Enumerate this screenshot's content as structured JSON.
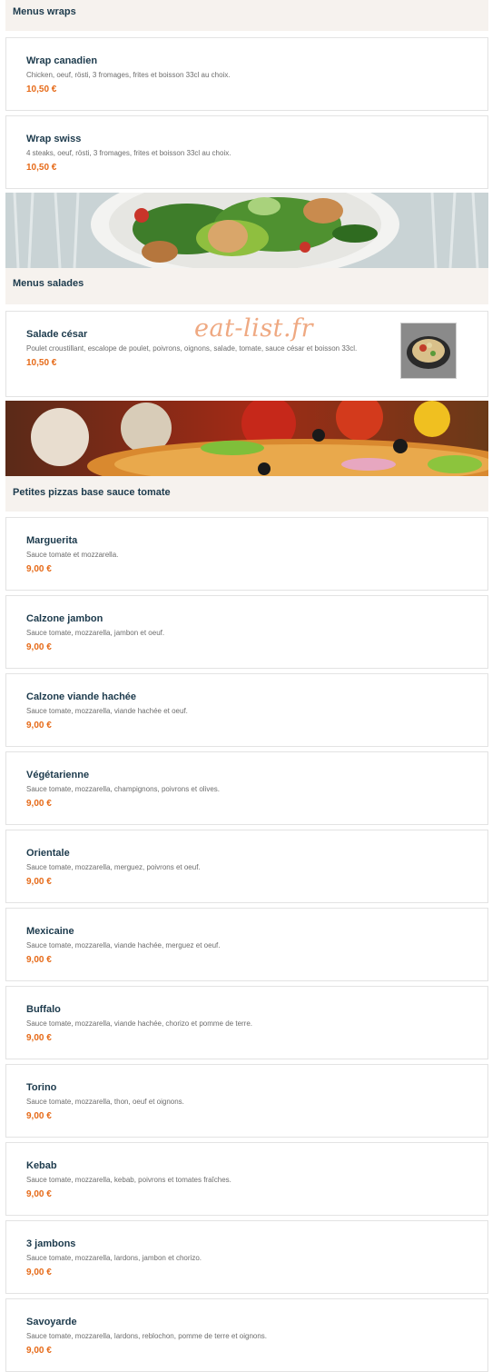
{
  "sections": {
    "wraps": {
      "title": "Menus wraps",
      "items": [
        {
          "name": "Wrap canadien",
          "desc": "Chicken, oeuf, rösti, 3 fromages, frites et boisson 33cl au choix.",
          "price": "10,50 €"
        },
        {
          "name": "Wrap swiss",
          "desc": "4 steaks, oeuf, rösti, 3 fromages, frites et boisson 33cl au choix.",
          "price": "10,50 €"
        }
      ]
    },
    "salades": {
      "title": "Menus salades",
      "items": [
        {
          "name": "Salade césar",
          "desc": "Poulet croustillant, escalope de poulet, poivrons, oignons, salade, tomate, sauce césar et boisson 33cl.",
          "price": "10,50 €"
        }
      ]
    },
    "pizzas": {
      "title": "Petites pizzas base sauce tomate",
      "items": [
        {
          "name": "Marguerita",
          "desc": "Sauce tomate et mozzarella.",
          "price": "9,00 €"
        },
        {
          "name": "Calzone jambon",
          "desc": "Sauce tomate, mozzarella, jambon et oeuf.",
          "price": "9,00 €"
        },
        {
          "name": "Calzone viande hachée",
          "desc": "Sauce tomate, mozzarella, viande hachée et oeuf.",
          "price": "9,00 €"
        },
        {
          "name": "Végétarienne",
          "desc": "Sauce tomate, mozzarella, champignons, poivrons et olives.",
          "price": "9,00 €"
        },
        {
          "name": "Orientale",
          "desc": "Sauce tomate, mozzarella, merguez, poivrons et oeuf.",
          "price": "9,00 €"
        },
        {
          "name": "Mexicaine",
          "desc": "Sauce tomate, mozzarella, viande hachée, merguez et oeuf.",
          "price": "9,00 €"
        },
        {
          "name": "Buffalo",
          "desc": "Sauce tomate, mozzarella, viande hachée, chorizo et pomme de terre.",
          "price": "9,00 €"
        },
        {
          "name": "Torino",
          "desc": "Sauce tomate, mozzarella, thon, oeuf et oignons.",
          "price": "9,00 €"
        },
        {
          "name": "Kebab",
          "desc": "Sauce tomate, mozzarella, kebab, poivrons et tomates fraîches.",
          "price": "9,00 €"
        },
        {
          "name": "3 jambons",
          "desc": "Sauce tomate, mozzarella, lardons, jambon et chorizo.",
          "price": "9,00 €"
        },
        {
          "name": "Savoyarde",
          "desc": "Sauce tomate, mozzarella, lardons, reblochon, pomme de terre et oignons.",
          "price": "9,00 €"
        }
      ]
    }
  },
  "watermark": "eat-list.fr",
  "colors": {
    "heading": "#1c3a4c",
    "price": "#e66a18",
    "section_bg": "#f6f2ee",
    "watermark": "#efa982"
  }
}
